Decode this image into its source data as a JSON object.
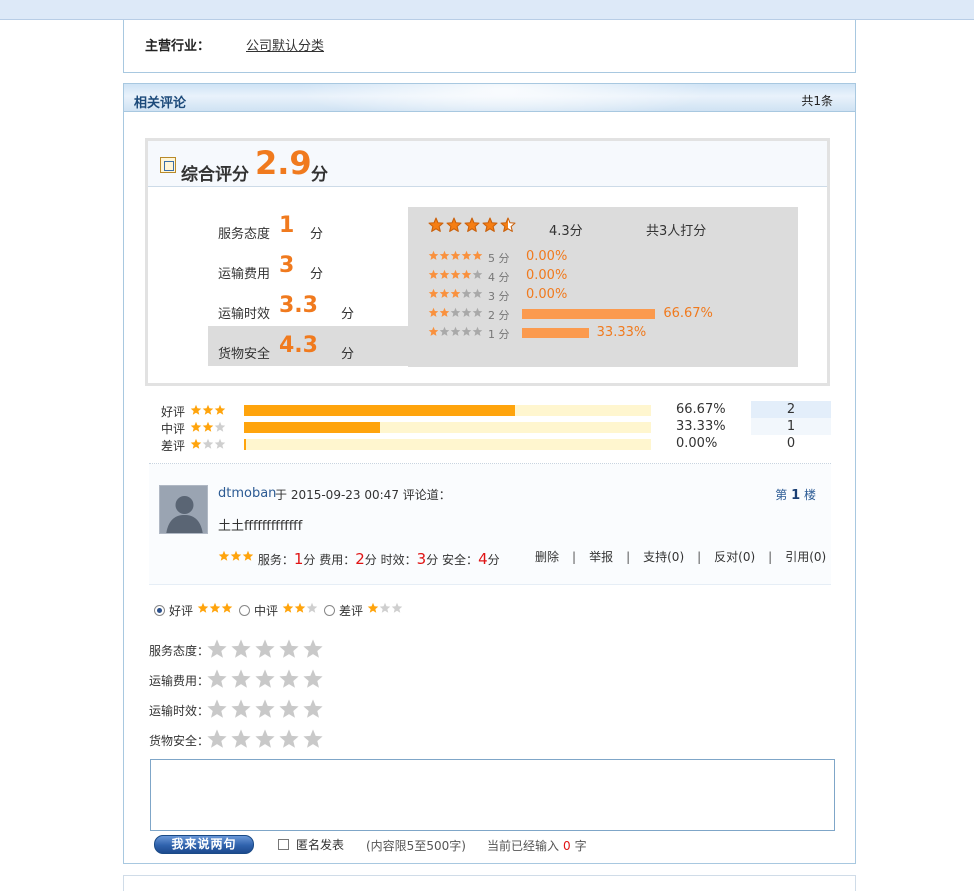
{
  "industry": {
    "label": "主营行业：",
    "value": "公司默认分类"
  },
  "comments_section": {
    "title": "相关评论",
    "count": "共1条",
    "overall": {
      "label": "综合评分",
      "value": "2.9",
      "unit": "分"
    },
    "aspects": [
      {
        "label": "服务态度",
        "value": "1",
        "unit": "分"
      },
      {
        "label": "运输费用",
        "value": "3",
        "unit": "分"
      },
      {
        "label": "运输时效",
        "value": "3.3",
        "unit": "分"
      },
      {
        "label": "货物安全",
        "value": "4.3",
        "unit": "分"
      }
    ],
    "distribution": {
      "avg": "4.3分",
      "avg_stars": 4.5,
      "total": "共3人打分",
      "rows": [
        {
          "stars": 5,
          "label": "5 分",
          "pct": "0.00%",
          "value": 0
        },
        {
          "stars": 4,
          "label": "4 分",
          "pct": "0.00%",
          "value": 0
        },
        {
          "stars": 3,
          "label": "3 分",
          "pct": "0.00%",
          "value": 0
        },
        {
          "stars": 2,
          "label": "2 分",
          "pct": "66.67%",
          "value": 66.67
        },
        {
          "stars": 1,
          "label": "1 分",
          "pct": "33.33%",
          "value": 33.33
        }
      ]
    },
    "summary": [
      {
        "label": "好评",
        "stars": 3,
        "pct": "66.67%",
        "value": 66.67,
        "count": "2",
        "count_bg": "#e3eefa"
      },
      {
        "label": "中评",
        "stars": 2,
        "pct": "33.33%",
        "value": 33.33,
        "count": "1",
        "count_bg": "#f2f7fc"
      },
      {
        "label": "差评",
        "stars": 1,
        "pct": "0.00%",
        "value": 0,
        "count": "0",
        "count_bg": "#ffffff"
      }
    ]
  },
  "comment": {
    "author": "dtmoban",
    "meta": "于 2015-09-23 00:47 评论道：",
    "floor_prefix": "第",
    "floor_num": "1",
    "floor_suffix": "楼",
    "text": "土土fffffffffffff",
    "scores": {
      "service_label": "服务：",
      "service": "1",
      "fee_label": "费用：",
      "fee": "2",
      "time_label": "时效：",
      "time": "3",
      "safety_label": "安全：",
      "safety": "4",
      "unit": "分"
    },
    "actions": [
      "删除",
      "举报",
      "支持(0)",
      "反对(0)",
      "引用(0)"
    ]
  },
  "form": {
    "choices": [
      {
        "label": "好评",
        "stars": 3,
        "selected": true
      },
      {
        "label": "中评",
        "stars": 2,
        "selected": false
      },
      {
        "label": "差评",
        "stars": 1,
        "selected": false
      }
    ],
    "rate_rows": [
      "服务态度：",
      "运输费用：",
      "运输时效：",
      "货物安全："
    ],
    "textarea_value": "",
    "submit_label": "我来说两句",
    "anonymous_label": "匿名发表",
    "limit_note": "(内容限5至500字)",
    "count_prefix": "当前已经输入",
    "count_value": "0",
    "count_suffix": "字"
  },
  "colors": {
    "accent_orange": "#f07a1e",
    "star_orange": "#ffa40c",
    "bar_orange": "#fb9a4e",
    "link_blue": "#2c5b94",
    "red": "#e01414"
  }
}
